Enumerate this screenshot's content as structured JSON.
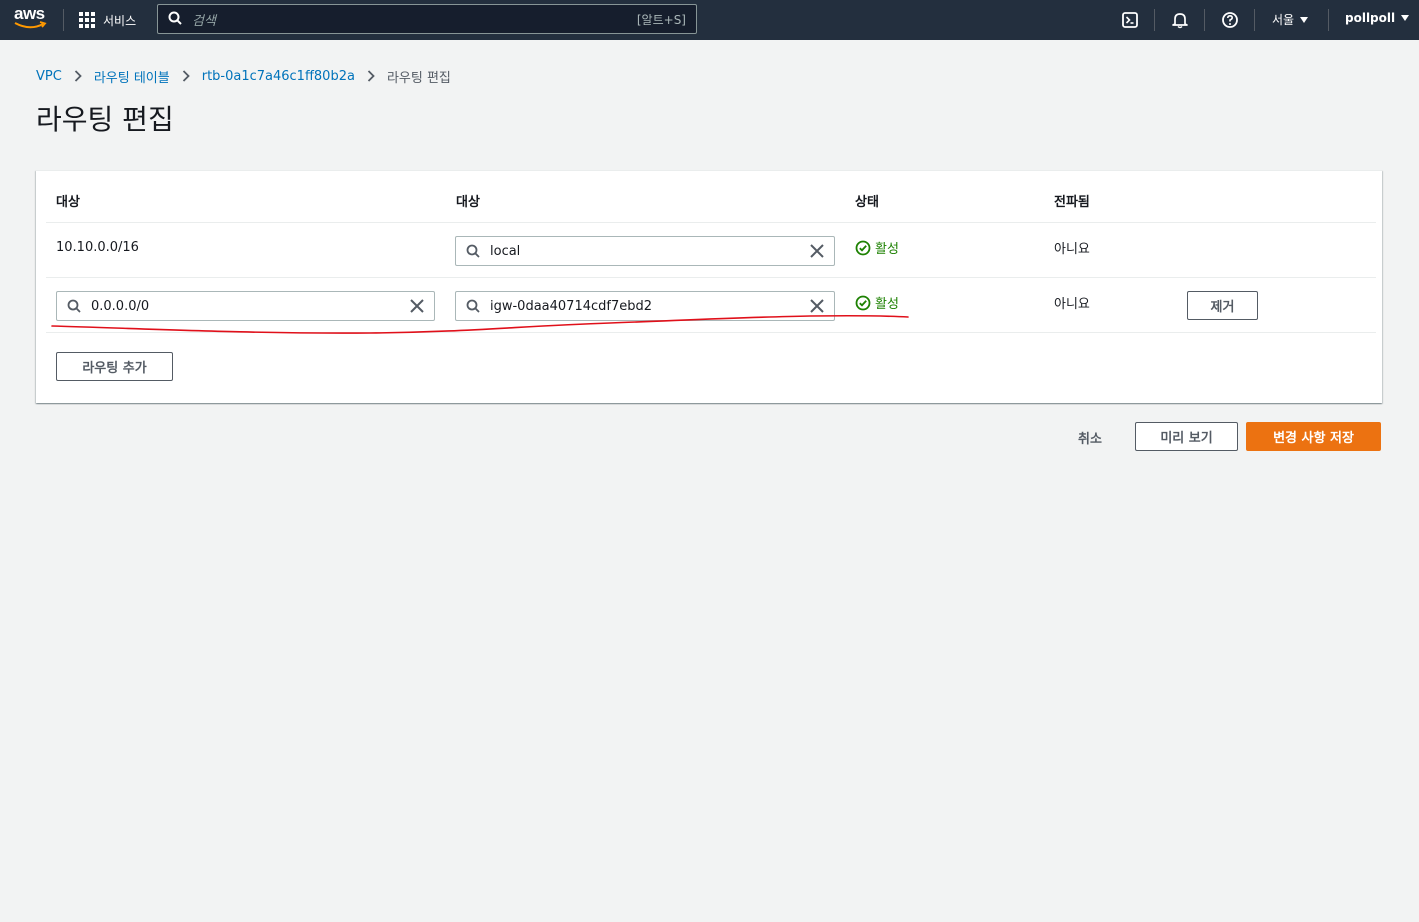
{
  "topnav": {
    "logo": "aws",
    "services_label": "서비스",
    "search_placeholder": "검색",
    "search_shortcut": "[알트+S]",
    "region_label": "서울",
    "account_label": "pollpoll",
    "icons": [
      "cloudshell-icon",
      "bell-icon",
      "help-icon"
    ]
  },
  "breadcrumb": {
    "items": [
      "VPC",
      "라우팅 테이블",
      "rtb-0a1c7a46c1ff80b2a"
    ],
    "current": "라우팅 편집"
  },
  "page": {
    "title": "라우팅 편집"
  },
  "table": {
    "headers": [
      "대상",
      "대상",
      "상태",
      "전파됨"
    ],
    "rows": [
      {
        "destination": "10.10.0.0/16",
        "target": "local",
        "status": "활성",
        "propagated": "아니요"
      },
      {
        "destination": "0.0.0.0/0",
        "target": "igw-0daa40714cdf7ebd2",
        "status": "활성",
        "propagated": "아니요",
        "remove_label": "제거"
      }
    ],
    "add_route_label": "라우팅 추가"
  },
  "footer": {
    "cancel_label": "취소",
    "preview_label": "미리 보기",
    "save_label": "변경 사항 저장"
  },
  "colors": {
    "nav_bg": "#232f3e",
    "link": "#0073bb",
    "success": "#1d8102",
    "primary": "#ec7211",
    "annotation": "#e0101a"
  }
}
